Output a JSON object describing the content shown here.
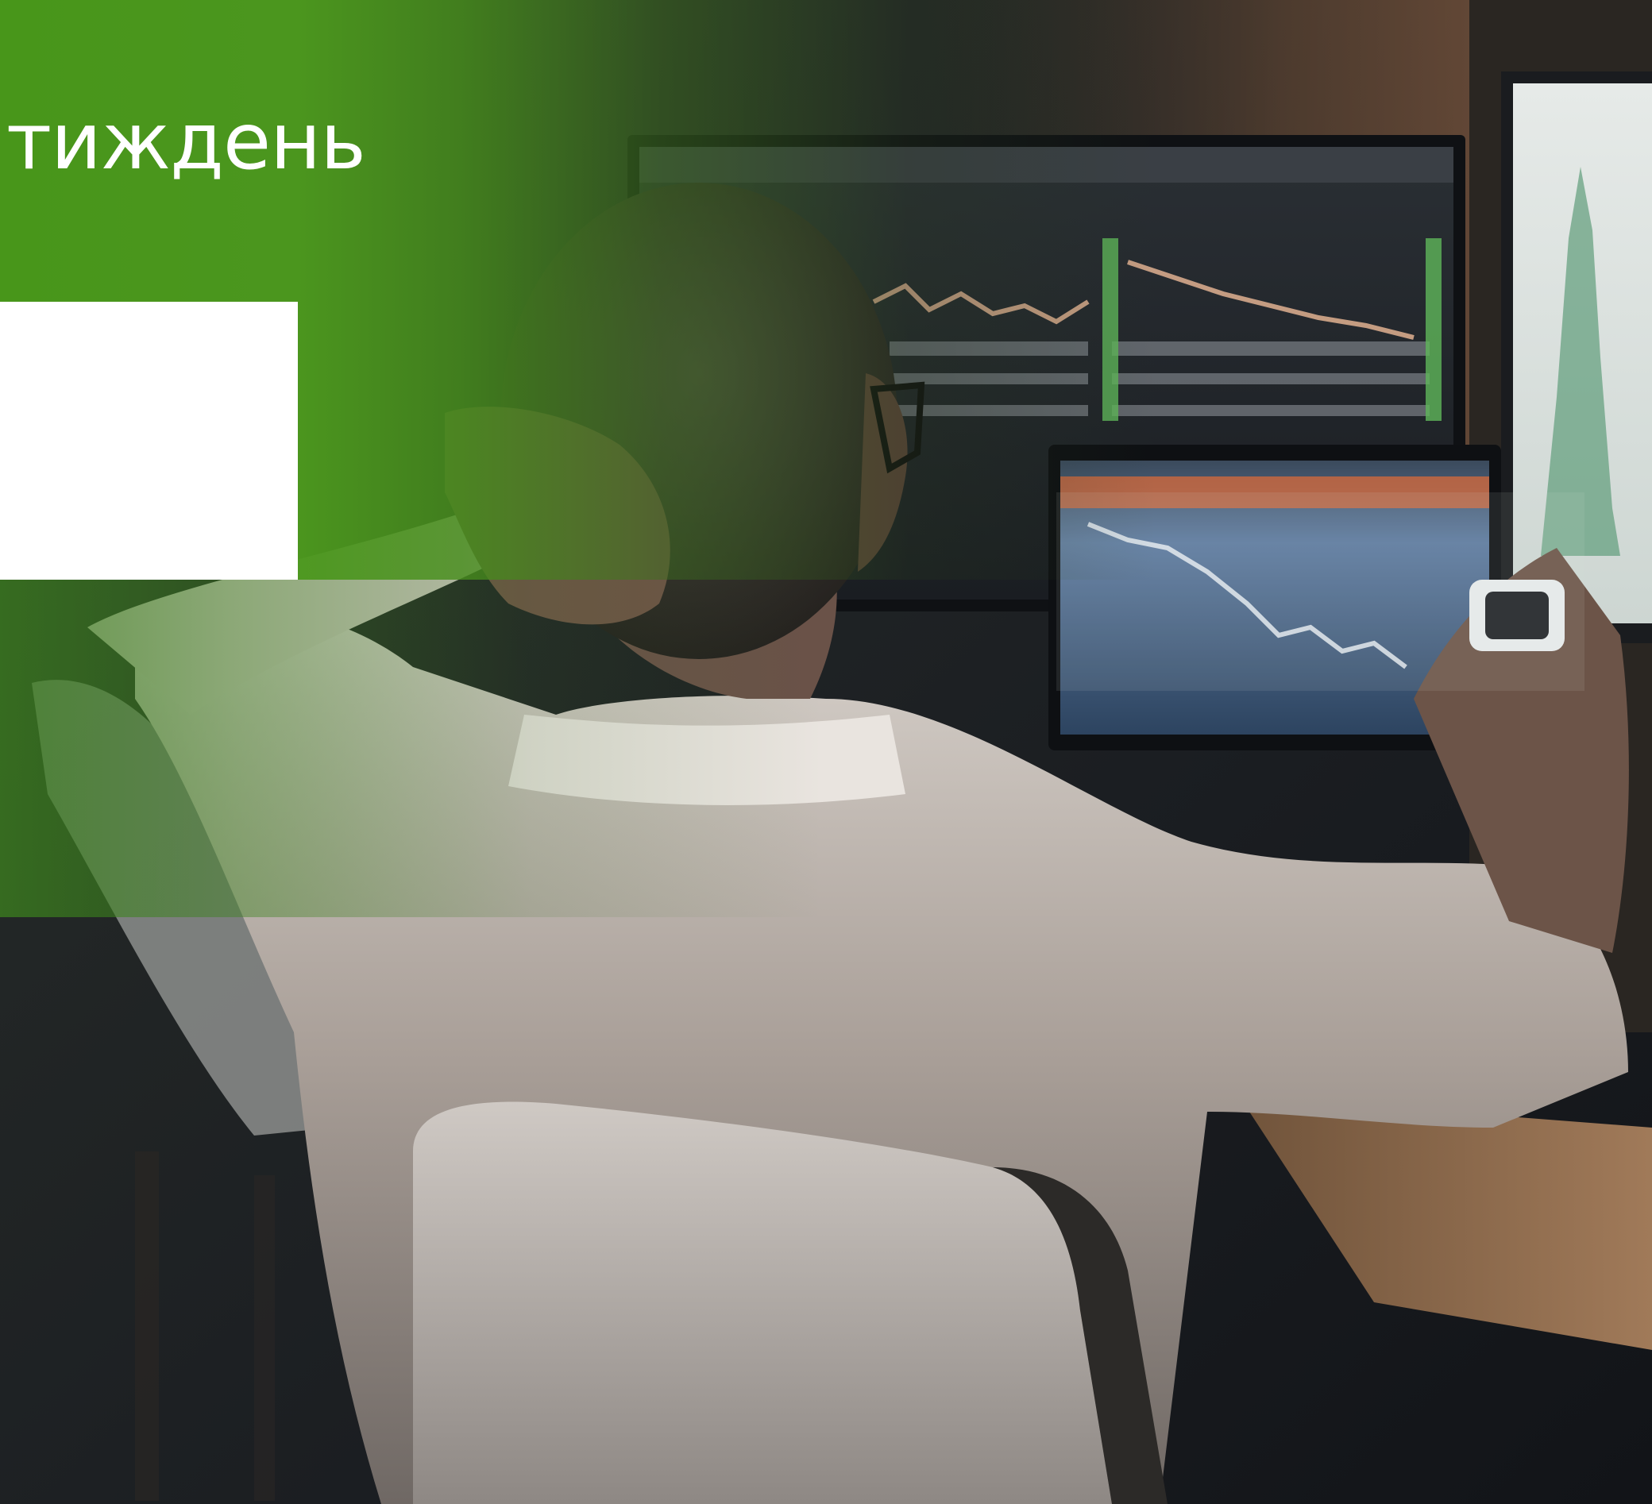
{
  "header": {
    "title": "тиждень"
  },
  "photo": {
    "subject": "trader-at-monitors"
  },
  "colors": {
    "brand_green": "#4c9a1e",
    "panel_white": "#ffffff"
  }
}
